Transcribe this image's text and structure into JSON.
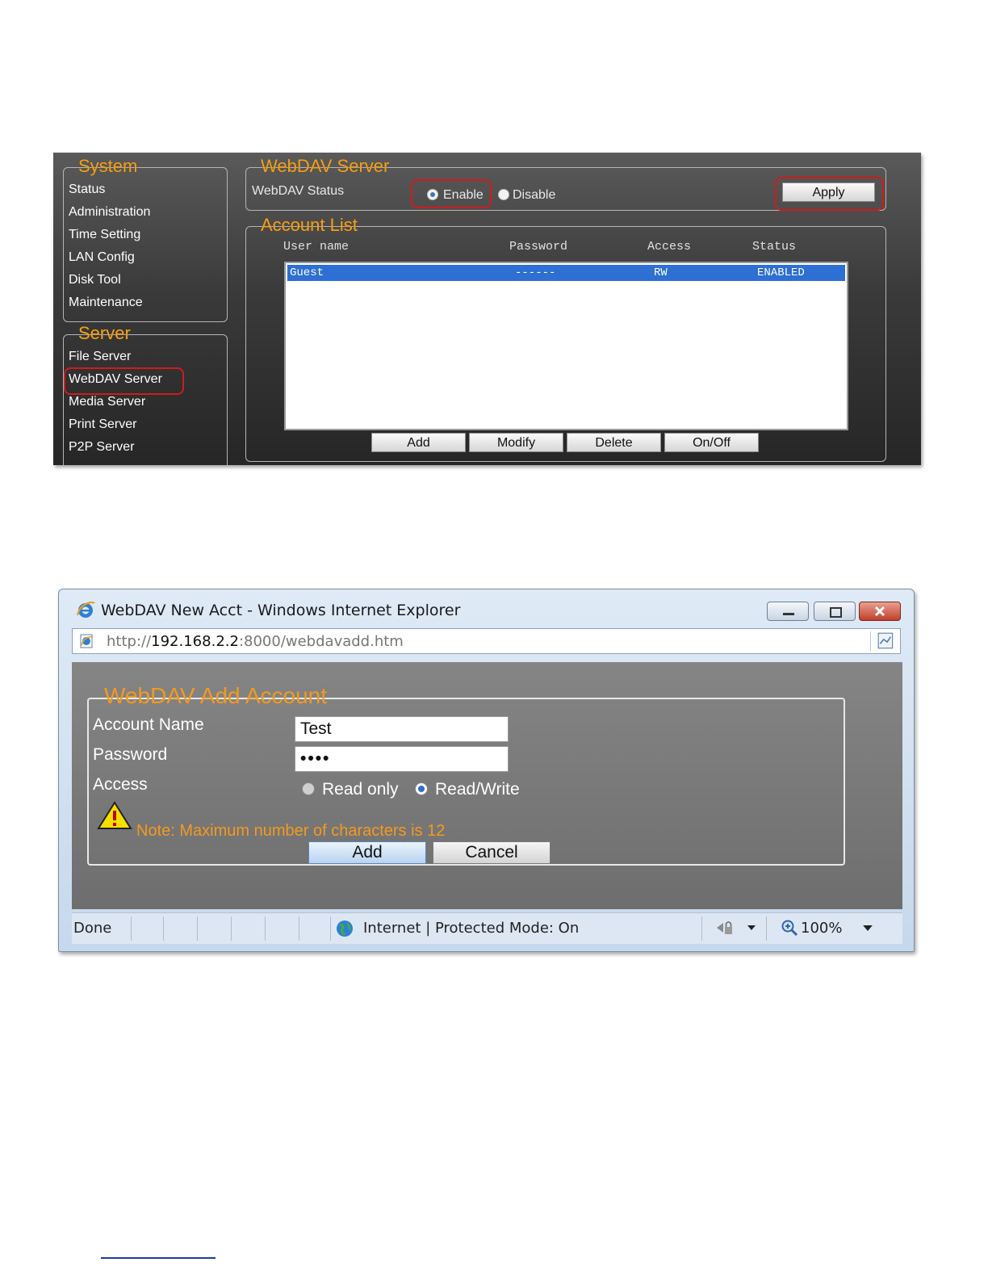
{
  "admin_panel": {
    "system_section": {
      "title": "System",
      "items": [
        "Status",
        "Administration",
        "Time Setting",
        "LAN Config",
        "Disk Tool",
        "Maintenance"
      ]
    },
    "server_section": {
      "title": "Server",
      "items": [
        "File Server",
        "WebDAV Server",
        "Media Server",
        "Print Server",
        "P2P Server"
      ],
      "highlighted": "WebDAV Server"
    },
    "webdav_server": {
      "title": "WebDAV Server",
      "status_label": "WebDAV Status",
      "enable_label": "Enable",
      "disable_label": "Disable",
      "selected": "Enable",
      "apply_label": "Apply"
    },
    "account_list": {
      "title": "Account List",
      "columns": [
        "User name",
        "Password",
        "Access",
        "Status"
      ],
      "rows": [
        {
          "user": "Guest",
          "password": "------",
          "access": "RW",
          "status": "ENABLED"
        }
      ],
      "buttons": [
        "Add",
        "Modify",
        "Delete",
        "On/Off"
      ]
    },
    "colors": {
      "section_title": "#f0a020",
      "highlight_ring": "#d11b1b",
      "selected_row": "#2d6fd2"
    }
  },
  "ie_window": {
    "title": "WebDAV New Acct - Windows Internet Explorer",
    "address": {
      "scheme": "http://",
      "host": "192.168.2.2",
      "rest": ":8000/webdavadd.htm"
    },
    "form": {
      "title": "WebDAV Add Account",
      "account_name_label": "Account Name",
      "account_name_value": "Test",
      "password_label": "Password",
      "password_value": "••••",
      "access_label": "Access",
      "read_only_label": "Read only",
      "read_write_label": "Read/Write",
      "selected_access": "Read/Write",
      "note": "Note: Maximum number of characters is 12",
      "add_label": "Add",
      "cancel_label": "Cancel"
    },
    "statusbar": {
      "done": "Done",
      "zone": "Internet | Protected Mode: On",
      "zoom": "100%"
    }
  }
}
